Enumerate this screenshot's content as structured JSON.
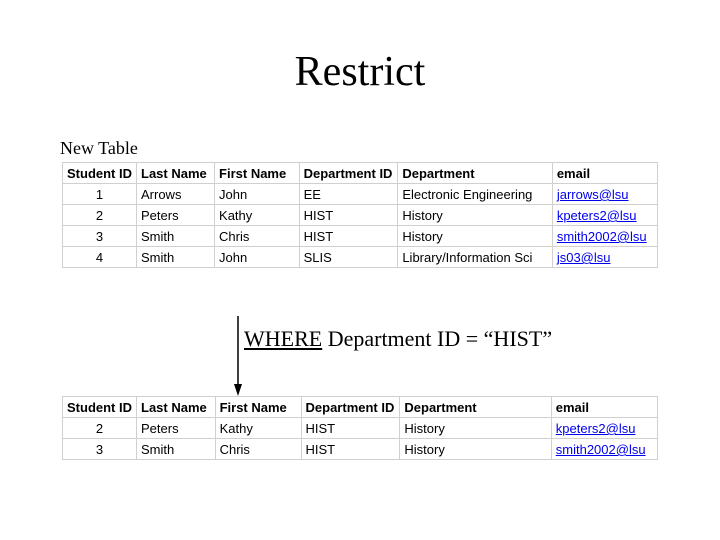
{
  "title": "Restrict",
  "subtitle": "New Table",
  "headers": {
    "student_id": "Student ID",
    "last_name": "Last Name",
    "first_name": "First Name",
    "dept_id": "Department ID",
    "department": "Department",
    "email": "email"
  },
  "table1": {
    "rows": [
      {
        "id": "1",
        "last": "Arrows",
        "first": "John",
        "did": "EE",
        "dep": "Electronic Engineering",
        "email": "jarrows@lsu"
      },
      {
        "id": "2",
        "last": "Peters",
        "first": "Kathy",
        "did": "HIST",
        "dep": "History",
        "email": "kpeters2@lsu"
      },
      {
        "id": "3",
        "last": "Smith",
        "first": "Chris",
        "did": "HIST",
        "dep": "History",
        "email": "smith2002@lsu"
      },
      {
        "id": "4",
        "last": "Smith",
        "first": "John",
        "did": "SLIS",
        "dep": "Library/Information Sci",
        "email": "js03@lsu"
      }
    ]
  },
  "where": {
    "keyword": "WHERE",
    "clause": " Department ID = “HIST”"
  },
  "table2": {
    "rows": [
      {
        "id": "2",
        "last": "Peters",
        "first": "Kathy",
        "did": "HIST",
        "dep": "History",
        "email": "kpeters2@lsu"
      },
      {
        "id": "3",
        "last": "Smith",
        "first": "Chris",
        "did": "HIST",
        "dep": "History",
        "email": "smith2002@lsu"
      }
    ]
  }
}
